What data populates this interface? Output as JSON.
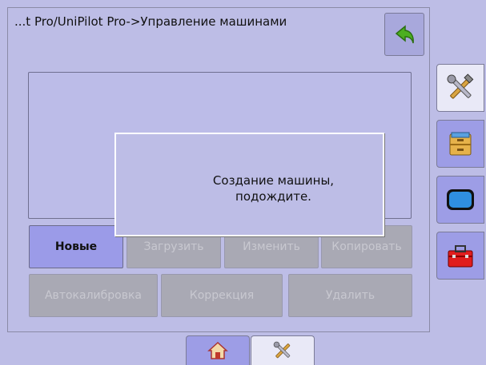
{
  "header": {
    "title": "...t Pro/UniPilot Pro->Управление машинами"
  },
  "buttons": {
    "row1": [
      "Новые",
      "Загрузить",
      "Изменить",
      "Копировать"
    ],
    "row2": [
      "Автокалибровка",
      "Коррекция",
      "Удалить"
    ]
  },
  "dialog": {
    "message": "Создание машины,\nподождите."
  },
  "side_tabs": [
    "tools-icon",
    "file-cabinet-icon",
    "monitor-icon",
    "toolbox-icon"
  ],
  "bottom_tabs": [
    "home-icon",
    "tools-icon"
  ],
  "colors": {
    "background": "#bdbde6",
    "active_button": "#9b9be8",
    "disabled_button": "#a9a9b4",
    "selected_tab": "#e9e9f7"
  }
}
